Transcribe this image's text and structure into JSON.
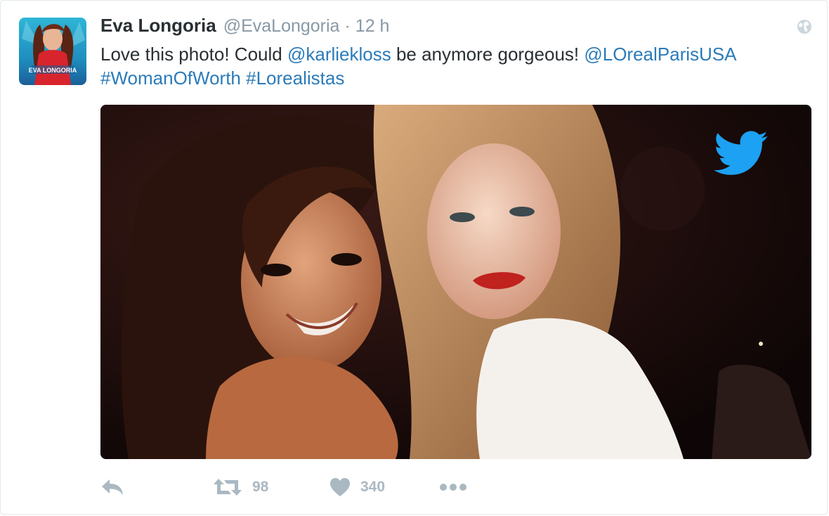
{
  "tweet": {
    "display_name": "Eva Longoria",
    "handle": "@EvaLongoria",
    "separator": "·",
    "timestamp": "12 h",
    "text": {
      "part1": "Love this photo! Could ",
      "mention1": "@karliekloss",
      "part2": " be anymore gorgeous! ",
      "mention2": "@LOrealParisUSA",
      "hashtag1": "#WomanOfWorth",
      "space": " ",
      "hashtag2": "#Lorealistas"
    },
    "avatar_text": "EVA LONGORIA",
    "retweet_count": "98",
    "like_count": "340"
  },
  "icons": {
    "globe": "globe-icon",
    "reply": "reply-icon",
    "retweet": "retweet-icon",
    "like": "heart-icon",
    "more": "more-dots-icon",
    "media_badge": "twitter-bird-icon"
  },
  "colors": {
    "text": "#292f33",
    "muted": "#8899a6",
    "link": "#2b7bb9",
    "action": "#aab8c2",
    "twitter_blue": "#1da1f2"
  }
}
